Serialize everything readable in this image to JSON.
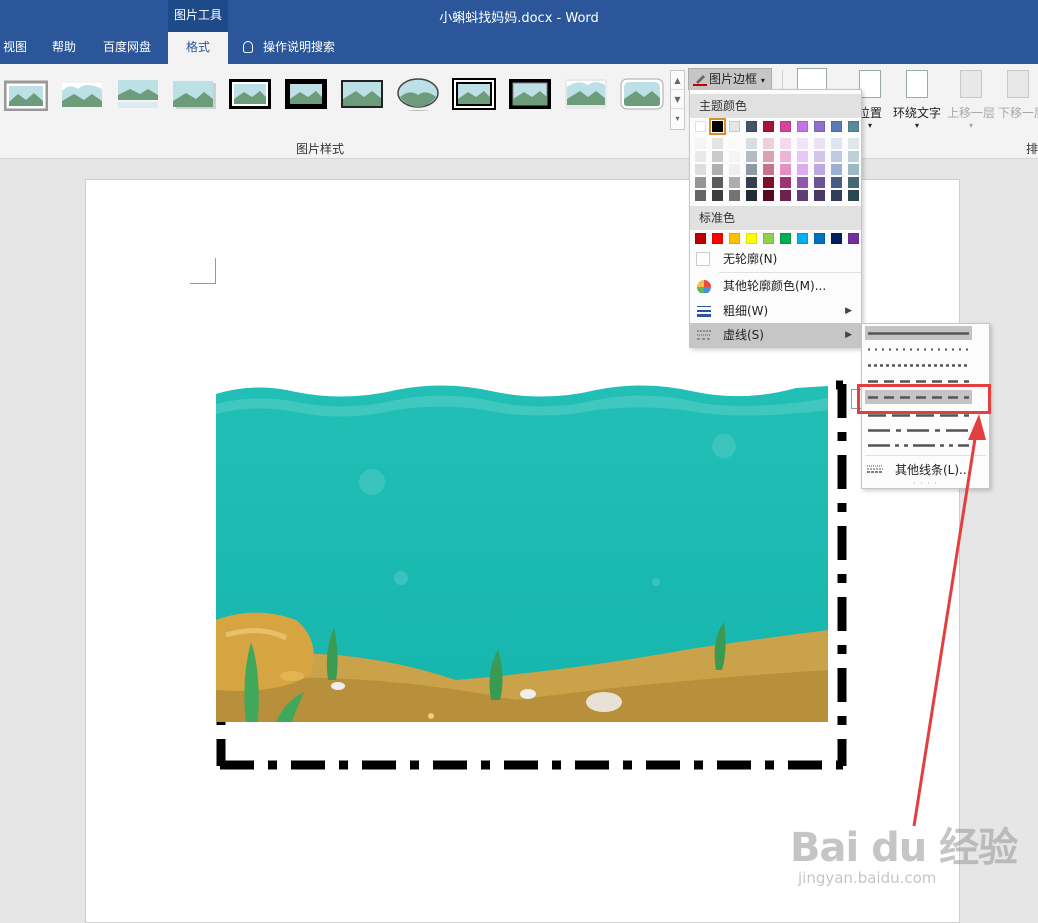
{
  "titlebar": {
    "context_tab": "图片工具",
    "document_title": "小蝌蚪找妈妈.docx  -  Word"
  },
  "tabs": [
    {
      "label": "视图",
      "active": false
    },
    {
      "label": "帮助",
      "active": false
    },
    {
      "label": "百度网盘",
      "active": false
    },
    {
      "label": "格式",
      "active": true
    }
  ],
  "tell_me": "操作说明搜索",
  "ribbon": {
    "group_picture_styles": "图片样式",
    "group_arrange_partial": "排",
    "picture_border_label": "图片边框",
    "buttons": {
      "position": "位置",
      "wrap_text": "环绕文字",
      "bring_forward": "上移一层",
      "send_backward": "下移一层"
    }
  },
  "dropdown": {
    "theme_colors_header": "主题颜色",
    "standard_colors_header": "标准色",
    "no_outline": "无轮廓(N)",
    "more_colors": "其他轮廓颜色(M)...",
    "weight": "粗细(W)",
    "dashes": "虚线(S)",
    "theme_colors": [
      "#ffffff",
      "#000000",
      "#e7e6e6",
      "#44546a",
      "#a5143d",
      "#d4449a",
      "#c473e8",
      "#8e6fca",
      "#5b7bb6",
      "#5a8a9a"
    ],
    "standard_colors": [
      "#c00000",
      "#ff0000",
      "#ffc000",
      "#ffff00",
      "#92d050",
      "#00b050",
      "#00b0f0",
      "#0070c0",
      "#002060",
      "#7030a0"
    ]
  },
  "submenu": {
    "more_lines": "其他线条(L)...",
    "selected_dash_style": "dash"
  },
  "watermark": {
    "brand": "Bai du 经验",
    "url": "jingyan.baidu.com"
  },
  "colors": {
    "title_bar": "#2b579a",
    "highlight_annotation": "#e43f3f",
    "water": "#18b8b0",
    "sand": "#c9a24a"
  }
}
